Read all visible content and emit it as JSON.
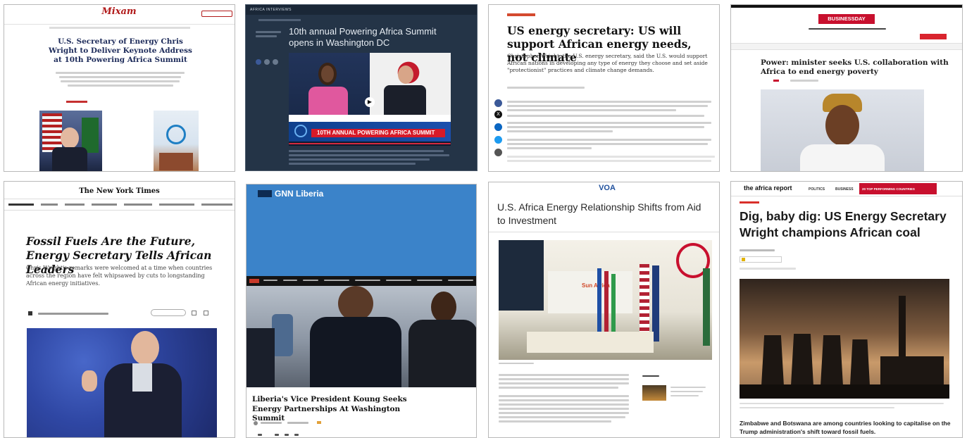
{
  "tiles": [
    {
      "id": "t1",
      "logo": "Mixam",
      "headline": "U.S. Secretary of Energy Chris Wright to Deliver Keynote Address at 10th Powering Africa Summit"
    },
    {
      "id": "t2",
      "section_label": "AFRICA INTERVIEWS",
      "headline": "10th annual Powering Africa Summit opens in Washington DC",
      "banner_text": "10TH ANNUAL POWERING AFRICA SUMMIT"
    },
    {
      "id": "t3",
      "headline": "US energy secretary: US will support African energy needs, not climate",
      "subhead": "Christopher Wright, the U.S. energy secretary, said the U.S. would support African nations in developing any type of energy they choose and set aside \"protectionist\" practices and climate change demands."
    },
    {
      "id": "t4",
      "logo": "BUSINESSDAY",
      "headline": "Power: minister seeks U.S. collaboration with Africa to end energy poverty"
    },
    {
      "id": "t5",
      "logo": "The New York Times",
      "headline": "Fossil Fuels Are the Future, Energy Secretary Tells African Leaders",
      "subhead": "Chris Wright's remarks were welcomed at a time when countries across the region have felt whipsawed by cuts to longstanding African energy initiatives."
    },
    {
      "id": "t6",
      "logo": "GNN Liberia",
      "headline": "Liberia's Vice President Koung Seeks Energy Partnerships At Washington Summit"
    },
    {
      "id": "t7",
      "logo": "VOA",
      "headline": "U.S. Africa Energy Relationship Shifts from Aid to Investment"
    },
    {
      "id": "t8",
      "logo": "the africa report",
      "nav": [
        "POLITICS",
        "BUSINESS",
        "20 TOP PERFORMING COUNTRIES"
      ],
      "headline": "Dig, baby dig: US Energy Secretary Wright champions African coal",
      "subhead": "Zimbabwe and Botswana are among countries looking to capitalise on the Trump administration's shift toward fossil fuels."
    }
  ]
}
